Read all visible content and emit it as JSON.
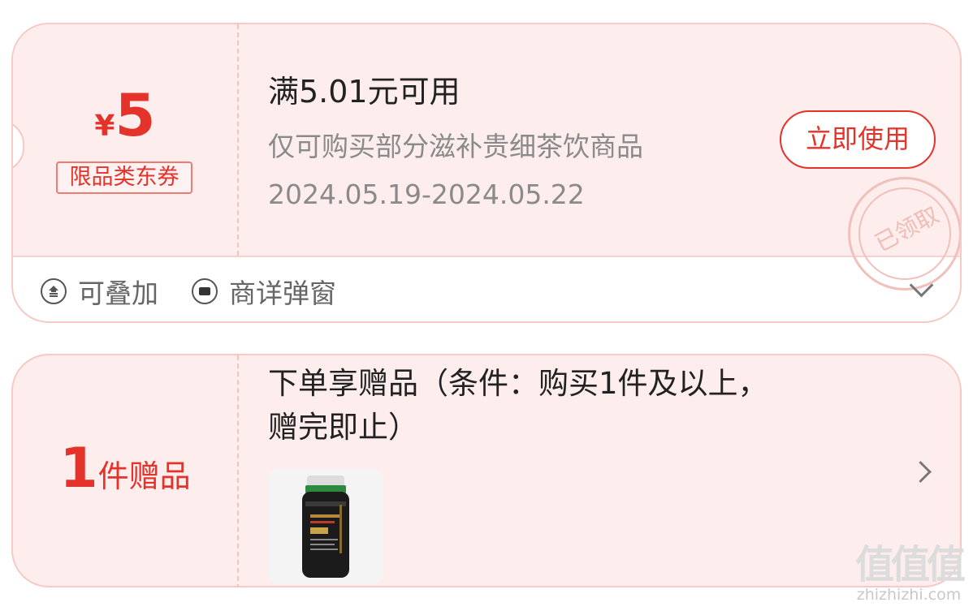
{
  "coupon": {
    "currency": "¥",
    "amount": "5",
    "tag": "限品类东券",
    "title": "满5.01元可用",
    "description": "仅可购买部分滋补贵细茶饮商品",
    "date_range": "2024.05.19-2024.05.22",
    "use_button": "立即使用",
    "stamp": "已领取",
    "features": [
      {
        "icon": "stack-icon",
        "label": "可叠加"
      },
      {
        "icon": "popup-icon",
        "label": "商详弹窗"
      }
    ],
    "expand_icon": "chevron-down-icon"
  },
  "gift": {
    "count": "1",
    "count_label": "件赠品",
    "title": "下单享赠品（条件：购买1件及以上，赠完即止）",
    "image": "product-bottle-image",
    "arrow_icon": "chevron-right-icon"
  },
  "watermark": {
    "logo": "值值值",
    "url": "zhizhizhi.com"
  },
  "colors": {
    "accent": "#e5322a",
    "card_bg": "#fdeeed",
    "card_border": "#f6c9c4"
  }
}
